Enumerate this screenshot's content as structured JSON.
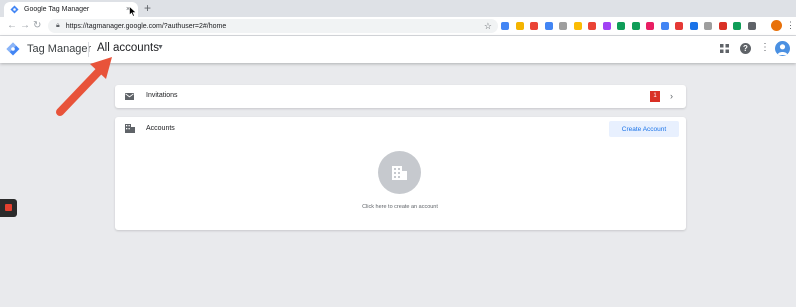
{
  "browser": {
    "tab_title": "Google Tag Manager",
    "tab_close": "×",
    "new_tab": "+",
    "url": "https://tagmanager.google.com/?authuser=2#/home",
    "profile_initial": "",
    "extension_colors": [
      "#4285f4",
      "#f4b400",
      "#ea4335",
      "#4285f4",
      "#9e9e9e",
      "#fbbc04",
      "#ea4335",
      "#a142f4",
      "#0f9d58",
      "#0f9d58",
      "#e91e63",
      "#4285f4",
      "#e53935",
      "#1a73e8",
      "#9e9e9e",
      "#d93025",
      "#0f9d58",
      "#5f6368"
    ]
  },
  "app": {
    "name": "Tag Manager",
    "account_selector": "All accounts",
    "logo_color": "#4285f4"
  },
  "invitations": {
    "label": "Invitations",
    "count": "1"
  },
  "accounts": {
    "label": "Accounts",
    "create_button": "Create Account",
    "empty_text": "Click here to create an account"
  },
  "colors": {
    "accent": "#1a73e8",
    "badge": "#d93025",
    "annotation_arrow": "#e8533a"
  }
}
